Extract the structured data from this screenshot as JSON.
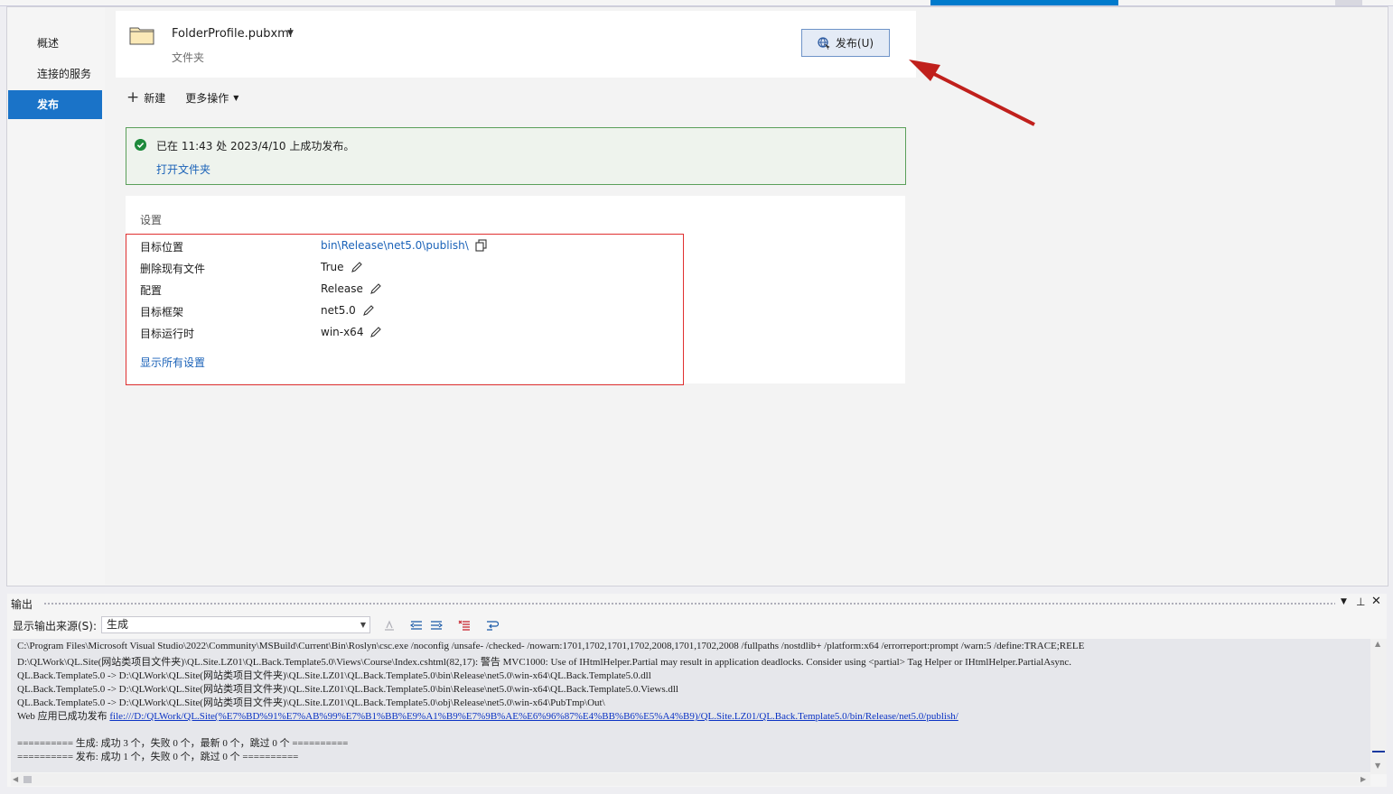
{
  "nav": {
    "items": [
      {
        "label": "概述"
      },
      {
        "label": "连接的服务"
      },
      {
        "label": "发布"
      }
    ]
  },
  "profile": {
    "name": "FolderProfile.pubxml",
    "type": "文件夹",
    "publish_button": "发布(U)"
  },
  "toolbar": {
    "new_label": "新建",
    "more_label": "更多操作"
  },
  "success": {
    "message": "已在 11:43 处 2023/4/10 上成功发布。",
    "open_folder": "打开文件夹"
  },
  "settings": {
    "title": "设置",
    "rows": [
      {
        "label": "目标位置",
        "value": "bin\\Release\\net5.0\\publish\\"
      },
      {
        "label": "删除现有文件",
        "value": "True"
      },
      {
        "label": "配置",
        "value": "Release"
      },
      {
        "label": "目标框架",
        "value": "net5.0"
      },
      {
        "label": "目标运行时",
        "value": "win-x64"
      }
    ],
    "show_all": "显示所有设置"
  },
  "output": {
    "title": "输出",
    "source_label": "显示输出来源(S):",
    "source_value": "生成",
    "lines": [
      "C:\\Program Files\\Microsoft Visual Studio\\2022\\Community\\MSBuild\\Current\\Bin\\Roslyn\\csc.exe /noconfig /unsafe- /checked- /nowarn:1701,1702,1701,1702,2008,1701,1702,2008 /fullpaths /nostdlib+ /platform:x64 /errorreport:prompt /warn:5 /define:TRACE;RELE",
      "D:\\QLWork\\QL.Site(网站类项目文件夹)\\QL.Site.LZ01\\QL.Back.Template5.0\\Views\\Course\\Index.cshtml(82,17): 警告 MVC1000: Use of IHtmlHelper.Partial may result in application deadlocks. Consider using <partial> Tag Helper or IHtmlHelper.PartialAsync.",
      "QL.Back.Template5.0 -> D:\\QLWork\\QL.Site(网站类项目文件夹)\\QL.Site.LZ01\\QL.Back.Template5.0\\bin\\Release\\net5.0\\win-x64\\QL.Back.Template5.0.dll",
      "QL.Back.Template5.0 -> D:\\QLWork\\QL.Site(网站类项目文件夹)\\QL.Site.LZ01\\QL.Back.Template5.0\\bin\\Release\\net5.0\\win-x64\\QL.Back.Template5.0.Views.dll",
      "QL.Back.Template5.0 -> D:\\QLWork\\QL.Site(网站类项目文件夹)\\QL.Site.LZ01\\QL.Back.Template5.0\\obj\\Release\\net5.0\\win-x64\\PubTmp\\Out\\"
    ],
    "web_prefix": "Web 应用已成功发布 ",
    "web_link": "file:///D:/QLWork/QL.Site(%E7%BD%91%E7%AB%99%E7%B1%BB%E9%A1%B9%E7%9B%AE%E6%96%87%E4%BB%B6%E5%A4%B9)/QL.Site.LZ01/QL.Back.Template5.0/bin/Release/net5.0/publish/",
    "build_summary": "========== 生成: 成功 3 个，失败 0 个，最新 0 个，跳过 0 个 ==========",
    "publish_summary": "========== 发布: 成功 1 个，失败 0 个，跳过 0 个 =========="
  },
  "colors": {
    "accent": "#1a73c8",
    "success_border": "#5a9f5a",
    "highlight_box": "#e03030",
    "arrow": "#c0201c",
    "link": "#1a62b8"
  }
}
